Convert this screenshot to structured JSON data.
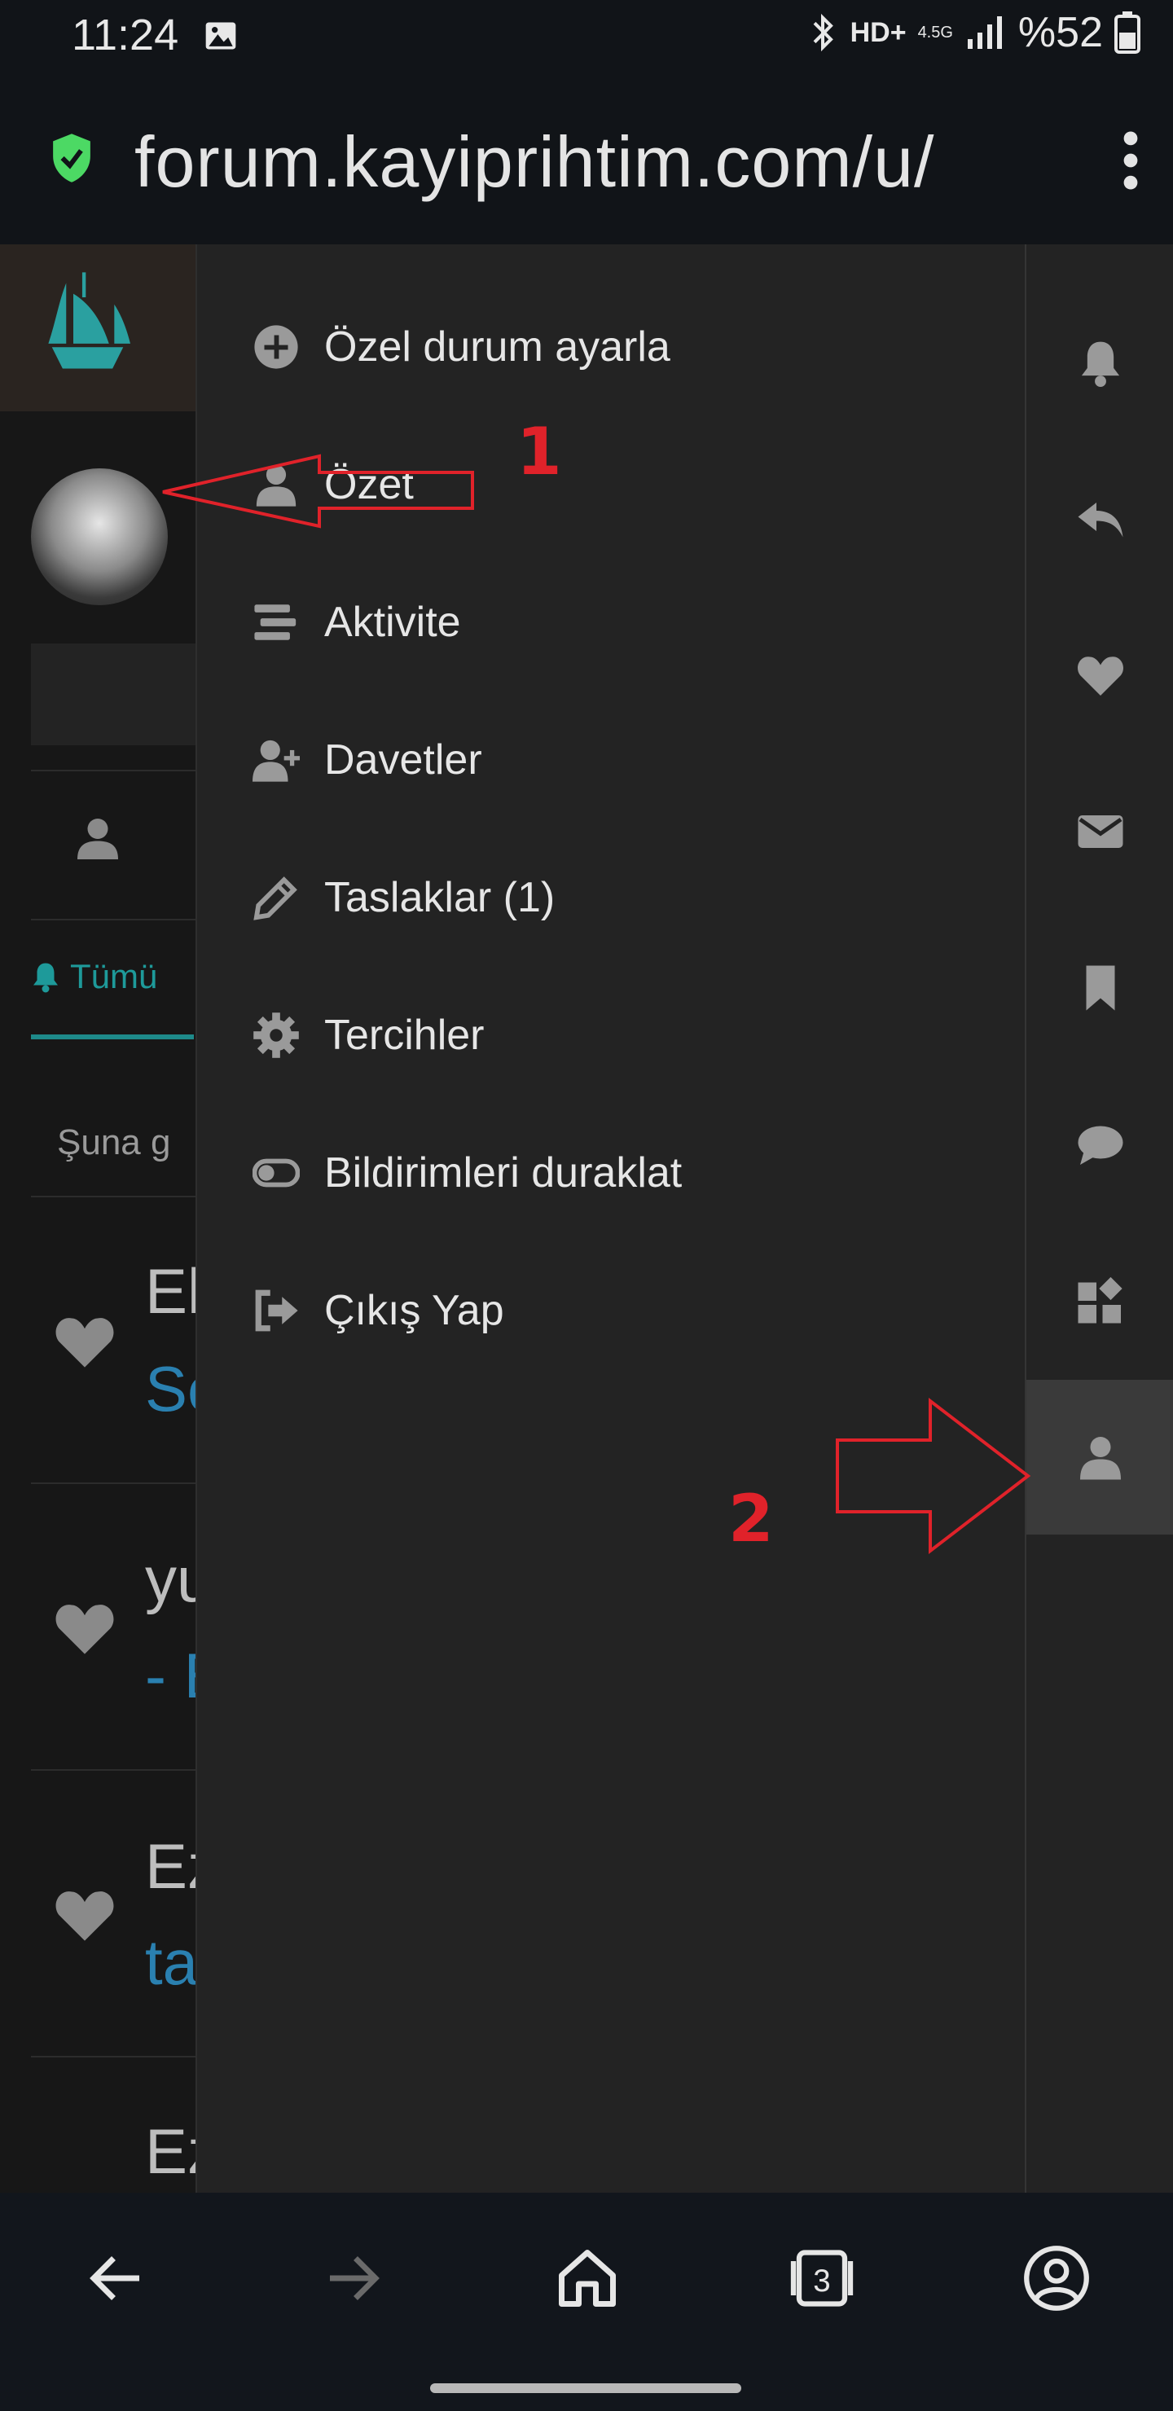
{
  "status_bar": {
    "time": "11:24",
    "network": "HD+",
    "network_type": "4.5G",
    "battery": "%52"
  },
  "url_bar": {
    "url": "forum.kayiprihtim.com/u/"
  },
  "background_page": {
    "tab_label": "Tümü",
    "filter_label": "Şuna g",
    "items": [
      {
        "title": "El",
        "link": "Se"
      },
      {
        "title": "yu",
        "link": "- E"
      },
      {
        "title": "Ez",
        "link": "ta"
      },
      {
        "title": "Ez",
        "link": ""
      }
    ]
  },
  "user_menu": {
    "items": [
      {
        "label": "Özel durum ayarla",
        "icon": "plus-circle-icon"
      },
      {
        "label": "Özet",
        "icon": "user-icon"
      },
      {
        "label": "Aktivite",
        "icon": "stream-icon"
      },
      {
        "label": "Davetler",
        "icon": "user-plus-icon"
      },
      {
        "label": "Taslaklar (1)",
        "icon": "pencil-icon"
      },
      {
        "label": "Tercihler",
        "icon": "gear-icon"
      },
      {
        "label": "Bildirimleri duraklat",
        "icon": "toggle-icon"
      },
      {
        "label": "Çıkış Yap",
        "icon": "sign-out-icon"
      }
    ]
  },
  "rail": {
    "icons": [
      "bell-icon",
      "reply-icon",
      "heart-icon",
      "envelope-icon",
      "bookmark-icon",
      "comment-icon",
      "widgets-icon",
      "user-icon"
    ],
    "active": "user-icon"
  },
  "annotations": {
    "label_1": "1",
    "label_2": "2"
  },
  "bottom_nav": {
    "tabs_count": "3"
  },
  "colors": {
    "drawer_bg": "#232323",
    "accent_teal": "#1e9a9a",
    "annotation_red": "#e0222a",
    "link_blue": "#2a80b0"
  }
}
